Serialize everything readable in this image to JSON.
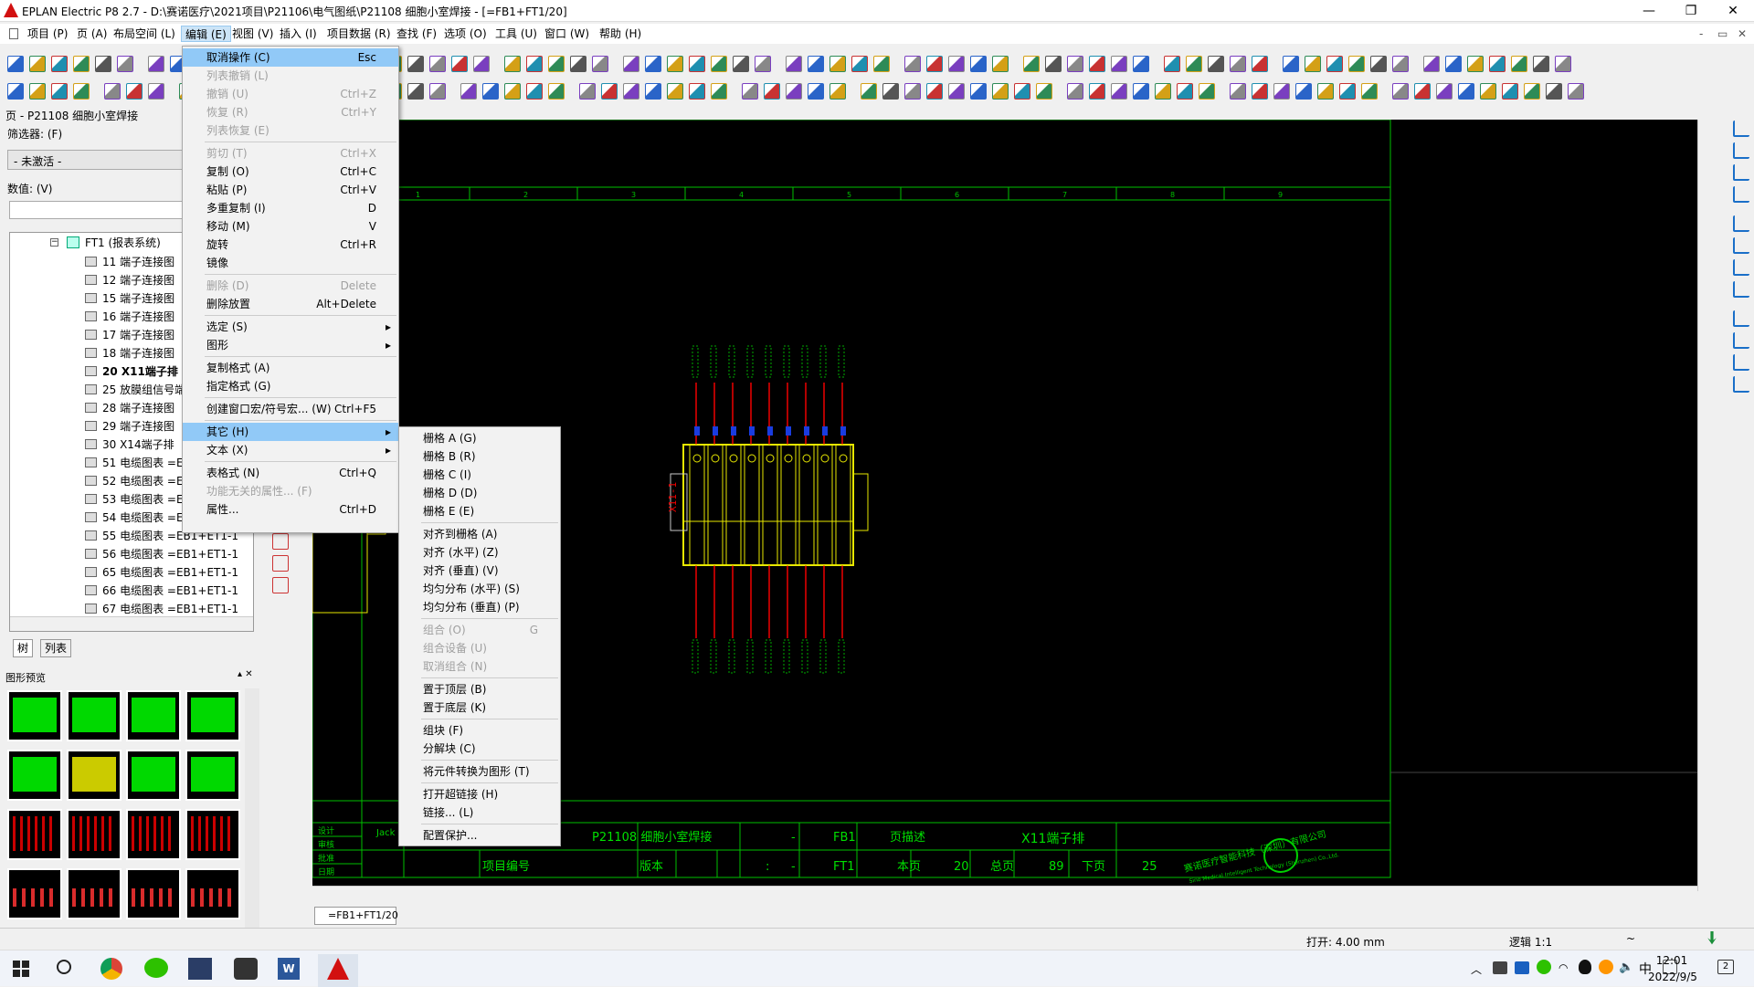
{
  "window": {
    "title": "EPLAN Electric P8 2.7 - D:\\赛诺医疗\\2021项目\\P21106\\电气图纸\\P21108 细胞小室焊接 - [=FB1+FT1/20]",
    "min": "—",
    "max": "❐",
    "close": "✕"
  },
  "menubar": [
    "项目 (P)",
    "页 (A)",
    "布局空间 (L)",
    "编辑 (E)",
    "视图 (V)",
    "插入 (I)",
    "项目数据 (R)",
    "查找 (F)",
    "选项 (O)",
    "工具 (U)",
    "窗口 (W)",
    "帮助 (H)"
  ],
  "inner_controls": [
    "-",
    "▭",
    "✕"
  ],
  "left": {
    "page_title": "页 - P21108 细胞小室焊接",
    "filter_label": "筛选器: (F)",
    "filter_value": "- 未激活 -",
    "value_label": "数值: (V)",
    "tree_root": "FT1 (报表系统)",
    "tree_items": [
      "11 端子连接图",
      "12 端子连接图",
      "15 端子连接图",
      "16 端子连接图",
      "17 端子连接图",
      "18 端子连接图",
      "20 X11端子排",
      "25 放膜组信号端",
      "28 端子连接图",
      "29 端子连接图",
      "30 X14端子排",
      "51 电缆图表 =E",
      "52 电缆图表 =E",
      "53 电缆图表 =E",
      "54 电缆图表 =E",
      "55 电缆图表 =EB1+ET1-1",
      "56 电缆图表 =EB1+ET1-1",
      "65 电缆图表 =EB1+ET1-1",
      "66 电缆图表 =EB1+ET1-1",
      "67 电缆图表 =EB1+ET1-1"
    ],
    "tab_tree": "树",
    "tab_list": "列表",
    "preview_title": "图形预览"
  },
  "edit_menu": [
    {
      "label": "取消操作 (C)",
      "key": "Esc",
      "state": "hl"
    },
    {
      "label": "列表撤销 (L)",
      "key": "",
      "state": "dis"
    },
    {
      "label": "撤销 (U)",
      "key": "Ctrl+Z",
      "state": "dis"
    },
    {
      "label": "恢复 (R)",
      "key": "Ctrl+Y",
      "state": "dis"
    },
    {
      "label": "列表恢复 (E)",
      "key": "",
      "state": "dis"
    },
    {
      "label": "剪切 (T)",
      "key": "Ctrl+X",
      "state": "dis"
    },
    {
      "label": "复制 (O)",
      "key": "Ctrl+C",
      "state": ""
    },
    {
      "label": "粘贴 (P)",
      "key": "Ctrl+V",
      "state": ""
    },
    {
      "label": "多重复制 (I)",
      "key": "D",
      "state": ""
    },
    {
      "label": "移动 (M)",
      "key": "V",
      "state": ""
    },
    {
      "label": "旋转",
      "key": "Ctrl+R",
      "state": ""
    },
    {
      "label": "镜像",
      "key": "",
      "state": ""
    },
    {
      "label": "删除 (D)",
      "key": "Delete",
      "state": "dis"
    },
    {
      "label": "删除放置",
      "key": "Alt+Delete",
      "state": ""
    },
    {
      "label": "选定 (S)",
      "key": "",
      "state": "sub"
    },
    {
      "label": "图形",
      "key": "",
      "state": "sub"
    },
    {
      "label": "复制格式 (A)",
      "key": "",
      "state": ""
    },
    {
      "label": "指定格式 (G)",
      "key": "",
      "state": ""
    },
    {
      "label": "创建窗口宏/符号宏... (W)",
      "key": "Ctrl+F5",
      "state": ""
    },
    {
      "label": "其它 (H)",
      "key": "",
      "state": "subhl"
    },
    {
      "label": "文本 (X)",
      "key": "",
      "state": "sub"
    },
    {
      "label": "表格式 (N)",
      "key": "Ctrl+Q",
      "state": ""
    },
    {
      "label": "功能无关的属性... (F)",
      "key": "",
      "state": "dis"
    },
    {
      "label": "属性...",
      "key": "Ctrl+D",
      "state": ""
    }
  ],
  "other_menu": [
    {
      "label": "栅格 A (G)",
      "key": "",
      "state": ""
    },
    {
      "label": "栅格 B (R)",
      "key": "",
      "state": ""
    },
    {
      "label": "栅格 C (I)",
      "key": "",
      "state": ""
    },
    {
      "label": "栅格 D (D)",
      "key": "",
      "state": ""
    },
    {
      "label": "栅格 E (E)",
      "key": "",
      "state": ""
    },
    {
      "label": "对齐到栅格 (A)",
      "key": "",
      "state": ""
    },
    {
      "label": "对齐 (水平) (Z)",
      "key": "",
      "state": ""
    },
    {
      "label": "对齐 (垂直) (V)",
      "key": "",
      "state": ""
    },
    {
      "label": "均匀分布 (水平) (S)",
      "key": "",
      "state": ""
    },
    {
      "label": "均匀分布 (垂直) (P)",
      "key": "",
      "state": ""
    },
    {
      "label": "组合 (O)",
      "key": "G",
      "state": "dis"
    },
    {
      "label": "组合设备 (U)",
      "key": "",
      "state": "dis"
    },
    {
      "label": "取消组合 (N)",
      "key": "",
      "state": "dis"
    },
    {
      "label": "置于顶层 (B)",
      "key": "",
      "state": ""
    },
    {
      "label": "置于底层 (K)",
      "key": "",
      "state": ""
    },
    {
      "label": "组块 (F)",
      "key": "",
      "state": ""
    },
    {
      "label": "分解块 (C)",
      "key": "",
      "state": ""
    },
    {
      "label": "将元件转换为图形 (T)",
      "key": "",
      "state": ""
    },
    {
      "label": "打开超链接 (H)",
      "key": "",
      "state": ""
    },
    {
      "label": "链接... (L)",
      "key": "",
      "state": ""
    },
    {
      "label": "配置保护...",
      "key": "",
      "state": ""
    }
  ],
  "drawing": {
    "columns": [
      "1",
      "2",
      "3",
      "4",
      "5",
      "6",
      "7",
      "8",
      "9"
    ],
    "strip_label": "X11-1",
    "title_block": {
      "design": "设计",
      "designer": "Jack",
      "check": "审核",
      "approve": "批准",
      "date": "日期",
      "project_name": "P21108 细胞小室焊接",
      "dash1": "-",
      "fb": "FB1",
      "page_desc_lbl": "页描述",
      "page_desc": "X11端子排",
      "proj_no": "项目编号",
      "version": "版本",
      "dash2": ":",
      "dash3": "-",
      "ft": "FT1",
      "this_page_lbl": "本页",
      "this_page": "20",
      "total_lbl": "总页",
      "total": "89",
      "next_lbl": "下页",
      "next": "25",
      "company": "赛诺医疗智能科技（深圳）有限公司",
      "company_en": "Sino Medical Intelligent Technology (Shenzhen) Co.,Ltd."
    }
  },
  "page_tab": "=FB1+FT1/20",
  "status": {
    "grid": "打开: 4.00 mm",
    "logic": "逻辑 1:1",
    "tilde": "~"
  },
  "taskbar": {
    "time": "12:01",
    "date": "2022/9/5",
    "ime": "中",
    "notif": "2"
  }
}
